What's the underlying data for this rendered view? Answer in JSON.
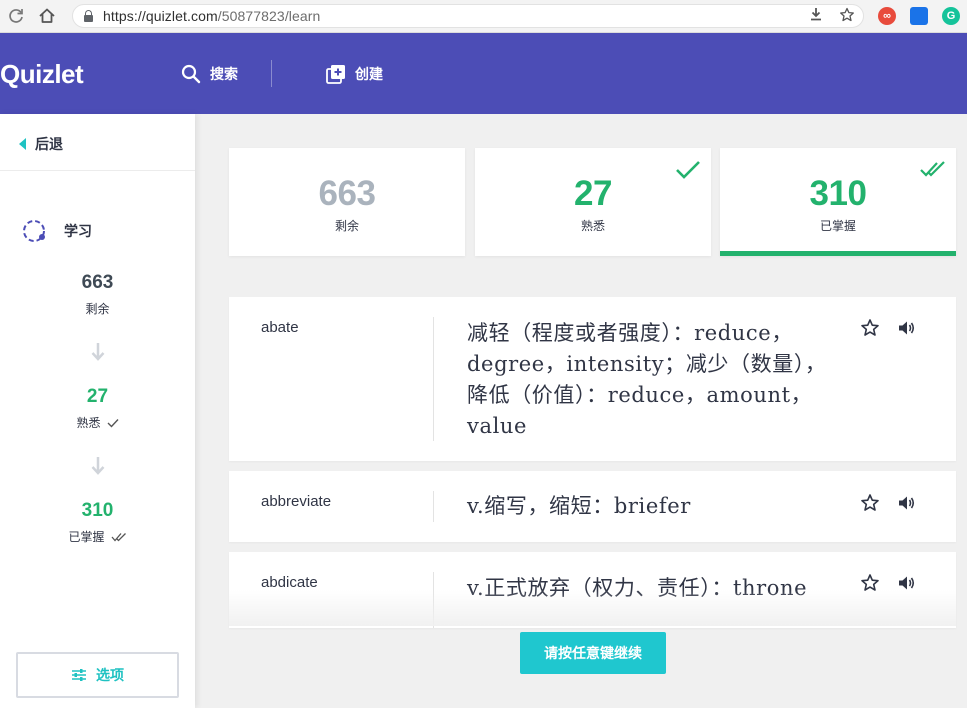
{
  "browser": {
    "url_host": "https://quizlet.com",
    "url_path": "/50877823/learn"
  },
  "header": {
    "logo": "Quizlet",
    "search_label": "搜索",
    "create_label": "创建"
  },
  "sidebar": {
    "back_label": "后退",
    "mode_label": "学习",
    "remaining": {
      "count": "663",
      "label": "剩余"
    },
    "familiar": {
      "count": "27",
      "label": "熟悉"
    },
    "mastered": {
      "count": "310",
      "label": "已掌握"
    },
    "options_label": "选项"
  },
  "cards": [
    {
      "count": "663",
      "label": "剩余"
    },
    {
      "count": "27",
      "label": "熟悉"
    },
    {
      "count": "310",
      "label": "已掌握"
    }
  ],
  "terms": [
    {
      "term": "abate",
      "definition": "减轻（程度或者强度）：reduce，degree，intensity；减少（数量），降低（价值）：reduce，amount，value"
    },
    {
      "term": "abbreviate",
      "definition": "v.缩写，缩短：briefer"
    },
    {
      "term": "abdicate",
      "definition": "v.正式放弃（权力、责任）：throne"
    }
  ],
  "continue_label": "请按任意键继续",
  "colors": {
    "header": "#4c4db6",
    "accent_teal": "#1fc2c2",
    "green": "#23b26d",
    "gray_count": "#aab3bd"
  }
}
